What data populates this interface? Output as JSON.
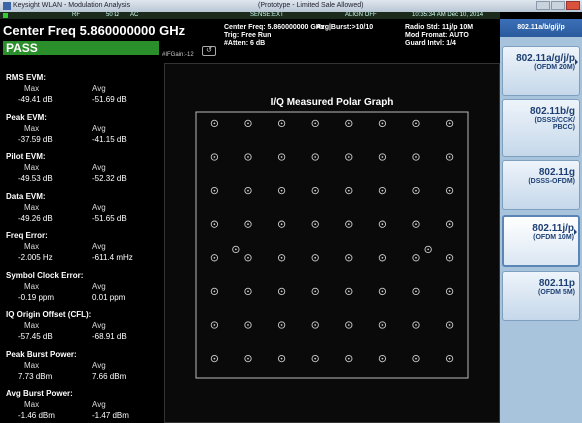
{
  "window": {
    "title": "Keysight WLAN - Modulation Analysis",
    "center_label": "(Prototype - Limited Sale Allowed)"
  },
  "status": {
    "rf": "RF",
    "zero": "50 Ω",
    "ac": "AC",
    "sense": "SENSE:EXT",
    "align": "ALIGN OFF",
    "datetime": "10:35:34 AM Dec 10, 2014"
  },
  "header": {
    "title": "Center Freq 5.860000000 GHz",
    "result": "PASS",
    "if_gain": "#IFGain:-12",
    "restart_icon": "restart-icon",
    "params_col1": [
      "Center Freq: 5.860000000 GHz",
      "Trig: Free Run",
      "#Atten: 6 dB"
    ],
    "params_col2": [
      "",
      "Avg|Burst:>10/10",
      ""
    ],
    "params_col3": [
      "Radio Std: 11j/p 10M",
      "Mod Fromat: AUTO",
      "Guard Intvl: 1/4"
    ]
  },
  "metrics": {
    "max_label": "Max",
    "avg_label": "Avg",
    "sections": [
      {
        "title": "RMS EVM:",
        "max": "-49.41  dB",
        "avg": "-51.69  dB"
      },
      {
        "title": "Peak EVM:",
        "max": "-37.59  dB",
        "avg": "-41.15  dB"
      },
      {
        "title": "Pilot EVM:",
        "max": "-49.53  dB",
        "avg": "-52.32  dB"
      },
      {
        "title": "Data EVM:",
        "max": "-49.26  dB",
        "avg": "-51.65  dB"
      },
      {
        "title": "Freq Error:",
        "max": "-2.005 Hz",
        "avg": "-611.4 mHz"
      },
      {
        "title": "Symbol Clock Error:",
        "max": "-0.19  ppm",
        "avg": "0.01  ppm"
      },
      {
        "title": "IQ Origin Offset (CFL):",
        "max": "-57.45  dB",
        "avg": "-68.91  dB"
      },
      {
        "title": "Peak Burst Power:",
        "max": "7.73  dBm",
        "avg": "7.66  dBm"
      },
      {
        "title": "Avg Burst Power:",
        "max": "-1.46  dBm",
        "avg": "-1.47  dBm"
      }
    ]
  },
  "graph": {
    "title": "I/Q Measured Polar Graph",
    "constellation": "64-QAM",
    "grid_levels": [
      -7,
      -5,
      -3,
      -1,
      1,
      3,
      5,
      7
    ],
    "pilots": [
      [
        -1,
        0
      ],
      [
        1,
        0
      ]
    ]
  },
  "softkeys": {
    "header": "802.11a/b/g/j/p",
    "items": [
      {
        "main": "802.11a/g/j/p",
        "sub": "(OFDM 20M)",
        "active": false
      },
      {
        "main": "802.11b/g",
        "sub": "(DSSS/CCK/ PBCC)",
        "active": false
      },
      {
        "main": "802.11g",
        "sub": "(DSSS-OFDM)",
        "active": false
      },
      {
        "main": "802.11j/p",
        "sub": "(OFDM 10M)",
        "active": true
      },
      {
        "main": "802.11p",
        "sub": "(OFDM 5M)",
        "active": false
      }
    ]
  },
  "colors": {
    "pass": "#2a8f2a",
    "point": "#cccccc",
    "softkey_text": "#1d3f73"
  }
}
